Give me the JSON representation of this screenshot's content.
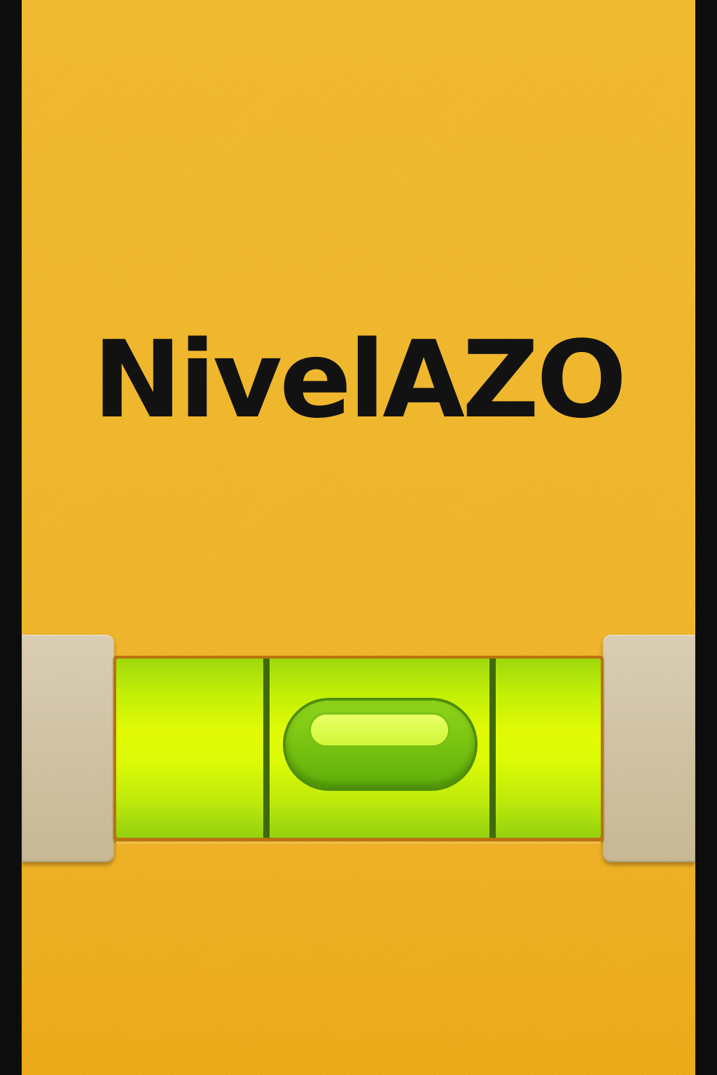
{
  "app": {
    "title": "NivelAZO"
  },
  "level": {
    "bubble_offset_fraction": 0.0,
    "state": "level"
  },
  "colors": {
    "frame": "#0d0d0d",
    "body_yellow": "#efb62b",
    "vial_green": "#dcfa07",
    "bubble_green": "#7cc612",
    "bracket_beige": "#cfc1a2",
    "title_text": "#121212"
  }
}
